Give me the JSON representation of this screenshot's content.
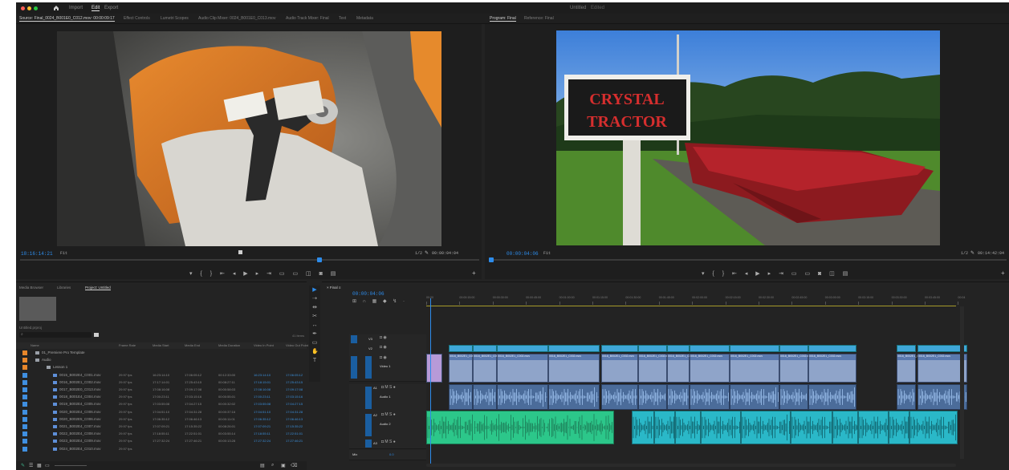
{
  "workspace": {
    "home_icon": "home-icon",
    "items": [
      "Import",
      "Edit",
      "Export"
    ],
    "active": "Edit",
    "title": "Untitled",
    "subtitle": "Edited"
  },
  "source_monitor": {
    "tabs": [
      "Source: Final_0024_B001E0_C012.mov: 00:00:09:17",
      "Effect Controls",
      "Lumetri Scopes",
      "Audio Clip Mixer: 0024_B001E0_C013.mov",
      "Audio Track Mixer: Final",
      "Text",
      "Metadata"
    ],
    "timecode_in": "18:16:14:21",
    "fit": "Fit",
    "resolution": "1/2",
    "timecode_out": "00:00:04:04"
  },
  "program_monitor": {
    "tabs": [
      "Program: Final",
      "Reference: Final"
    ],
    "timecode": "00:00:04:06",
    "fit": "Fit",
    "resolution": "1/2",
    "duration": "00:14:42:04",
    "sign_line1": "CRYSTAL",
    "sign_line2": "TRACTOR"
  },
  "project_panel": {
    "tabs": [
      "Media Browser",
      "Libraries",
      "Project: Untitled"
    ],
    "project_file": "Untitled.prproj",
    "search_placeholder": "",
    "item_count": "41 items",
    "columns": [
      "Name",
      "Frame Rate",
      "Media Start",
      "Media End",
      "Media Duration",
      "Video In Point",
      "Video Out Point"
    ],
    "rows": [
      {
        "name": "01_Premiere Pro Template",
        "type": "bin",
        "color": "#e8872b",
        "rate": "",
        "start": "",
        "end": "",
        "dur": "",
        "vin": "",
        "vout": ""
      },
      {
        "name": "Audio",
        "type": "bin",
        "color": "#e8872b",
        "rate": "",
        "start": "",
        "end": "",
        "dur": "",
        "vin": "",
        "vout": ""
      },
      {
        "name": "Lesson 1",
        "type": "bin",
        "color": "#e8872b",
        "rate": "",
        "start": "",
        "end": "",
        "dur": "",
        "vin": "",
        "vout": ""
      },
      {
        "name": "0015_B002E4_C001.mov",
        "type": "clip",
        "color": "#3f8fe0",
        "rate": "29.97 fps",
        "start": "16:23:14:10",
        "end": "17:06:05:12",
        "dur": "00:12:33:00",
        "vin": "16:23:14:10",
        "vout": "17:06:05:12"
      },
      {
        "name": "0016_B002E1_C002.mov",
        "type": "clip",
        "color": "#3f8fe0",
        "rate": "29.97 fps",
        "start": "17:17:14:01",
        "end": "17:25:43:15",
        "dur": "00:08:27:11",
        "vin": "17:18:15:01",
        "vout": "17:25:43:15"
      },
      {
        "name": "0017_B002E0_C013.mov",
        "type": "clip",
        "color": "#3f8fe0",
        "rate": "29.97 fps",
        "start": "17:08:16:08",
        "end": "17:09:17:08",
        "dur": "00:00:58:03",
        "vin": "17:08:16:08",
        "vout": "17:09:17:08"
      },
      {
        "name": "0018_B001E4_C004.mov",
        "type": "clip",
        "color": "#3f8fe0",
        "rate": "29.97 fps",
        "start": "17:00:23:11",
        "end": "17:03:15:16",
        "dur": "00:00:55:01",
        "vin": "17:00:23:11",
        "vout": "17:03:15:16"
      },
      {
        "name": "0019_B002E4_C005.mov",
        "type": "clip",
        "color": "#3f8fe0",
        "rate": "29.97 fps",
        "start": "17:03:55:08",
        "end": "17:04:27:15",
        "dur": "00:00:32:02",
        "vin": "17:03:55:08",
        "vout": "17:04:27:15"
      },
      {
        "name": "0020_B002E4_C006.mov",
        "type": "clip",
        "color": "#3f8fe0",
        "rate": "29.97 fps",
        "start": "17:04:51:10",
        "end": "17:04:31:28",
        "dur": "00:00:37:16",
        "vin": "17:04:51:10",
        "vout": "17:04:31:28"
      },
      {
        "name": "0020_B002E5_C006.mov",
        "type": "clip",
        "color": "#3f8fe0",
        "rate": "29.97 fps",
        "start": "17:06:35:12",
        "end": "17:06:46:13",
        "dur": "00:00:11:01",
        "vin": "17:06:35:12",
        "vout": "17:06:46:13"
      },
      {
        "name": "0021_B002E4_C007.mov",
        "type": "clip",
        "color": "#3f8fe0",
        "rate": "29.97 fps",
        "start": "17:07:09:21",
        "end": "17:15:35:22",
        "dur": "00:08:26:01",
        "vin": "17:07:09:21",
        "vout": "17:15:35:22"
      },
      {
        "name": "0022_B002E4_C008.mov",
        "type": "clip",
        "color": "#3f8fe0",
        "rate": "29.97 fps",
        "start": "17:18:55:11",
        "end": "17:22:51:01",
        "dur": "00:03:55:14",
        "vin": "17:18:55:11",
        "vout": "17:22:51:01"
      },
      {
        "name": "0023_B002E4_C009.mov",
        "type": "clip",
        "color": "#3f8fe0",
        "rate": "29.97 fps",
        "start": "17:27:32:24",
        "end": "17:27:46:21",
        "dur": "00:00:13:28",
        "vin": "17:27:32:24",
        "vout": "17:27:46:21"
      },
      {
        "name": "0024_B002E4_C010.mov",
        "type": "clip",
        "color": "#3f8fe0",
        "rate": "29.97 fps",
        "start": "",
        "end": "",
        "dur": "",
        "vin": "",
        "vout": ""
      }
    ]
  },
  "timeline": {
    "sequence_tab": "Final",
    "timecode": "00:00:04:06",
    "ruler": [
      "00:00",
      "00:00:15:00",
      "00:00:30:00",
      "00:00:45:00",
      "00:01:00:00",
      "00:01:15:00",
      "00:01:30:00",
      "00:01:45:00",
      "00:02:00:00",
      "00:02:15:00",
      "00:02:30:00",
      "00:02:45:00",
      "00:03:00:00",
      "00:03:15:00",
      "00:03:30:00",
      "00:03:45:00",
      "00:04"
    ],
    "tracks": {
      "v3": "V3",
      "v2": "V2",
      "v1": "V1",
      "video1": "Video 1",
      "a1": "A1",
      "audio1": "Audio 1",
      "a2": "A2",
      "audio2": "Audio 2",
      "a3": "A3",
      "mix": "Mix",
      "mix_value": "0.0"
    },
    "clip_name": "0016_B002E1_C002.mov",
    "playhead_fraction": 0.008
  },
  "colors": {
    "accent": "#2d8ceb",
    "panel": "#232323",
    "video_clip": "#8fa4c9",
    "audio_clip": "#4b6c9a",
    "music_clip": "#2cc78a",
    "cyan_clip": "#2ab8c8"
  }
}
